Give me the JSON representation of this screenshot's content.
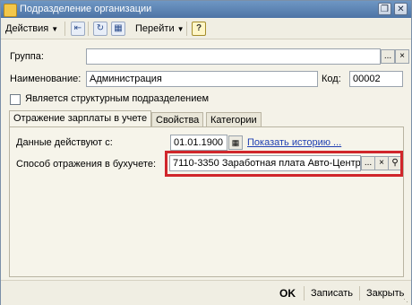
{
  "window": {
    "title": "Подразделение организации",
    "controls": {
      "restore": "❐",
      "close": "✕"
    }
  },
  "toolbar": {
    "actions_label": "Действия",
    "goto_label": "Перейти",
    "help_label": "?"
  },
  "form": {
    "group_label": "Группа:",
    "group_value": "",
    "name_label": "Наименование:",
    "name_value": "Администрация",
    "code_label": "Код:",
    "code_value": "00002",
    "structural_label": "Является структурным подразделением",
    "structural_checked": false
  },
  "tabs": [
    {
      "label": "Отражение зарплаты в учете",
      "active": true
    },
    {
      "label": "Свойства",
      "active": false
    },
    {
      "label": "Категории",
      "active": false
    }
  ],
  "salary_tab": {
    "valid_from_label": "Данные действуют с:",
    "valid_from_value": "01.01.1900",
    "show_history_link": "Показать историю ...",
    "accounting_label": "Способ отражения в бухучете:",
    "accounting_value": "7110-3350 Заработная плата Авто-Центр"
  },
  "buttons": {
    "select": "...",
    "clear": "×",
    "ok": "OK",
    "save": "Записать",
    "close": "Закрыть"
  },
  "colors": {
    "highlight": "#d0262b",
    "titlebar": "#4d74a5",
    "link": "#1f3fb2"
  }
}
